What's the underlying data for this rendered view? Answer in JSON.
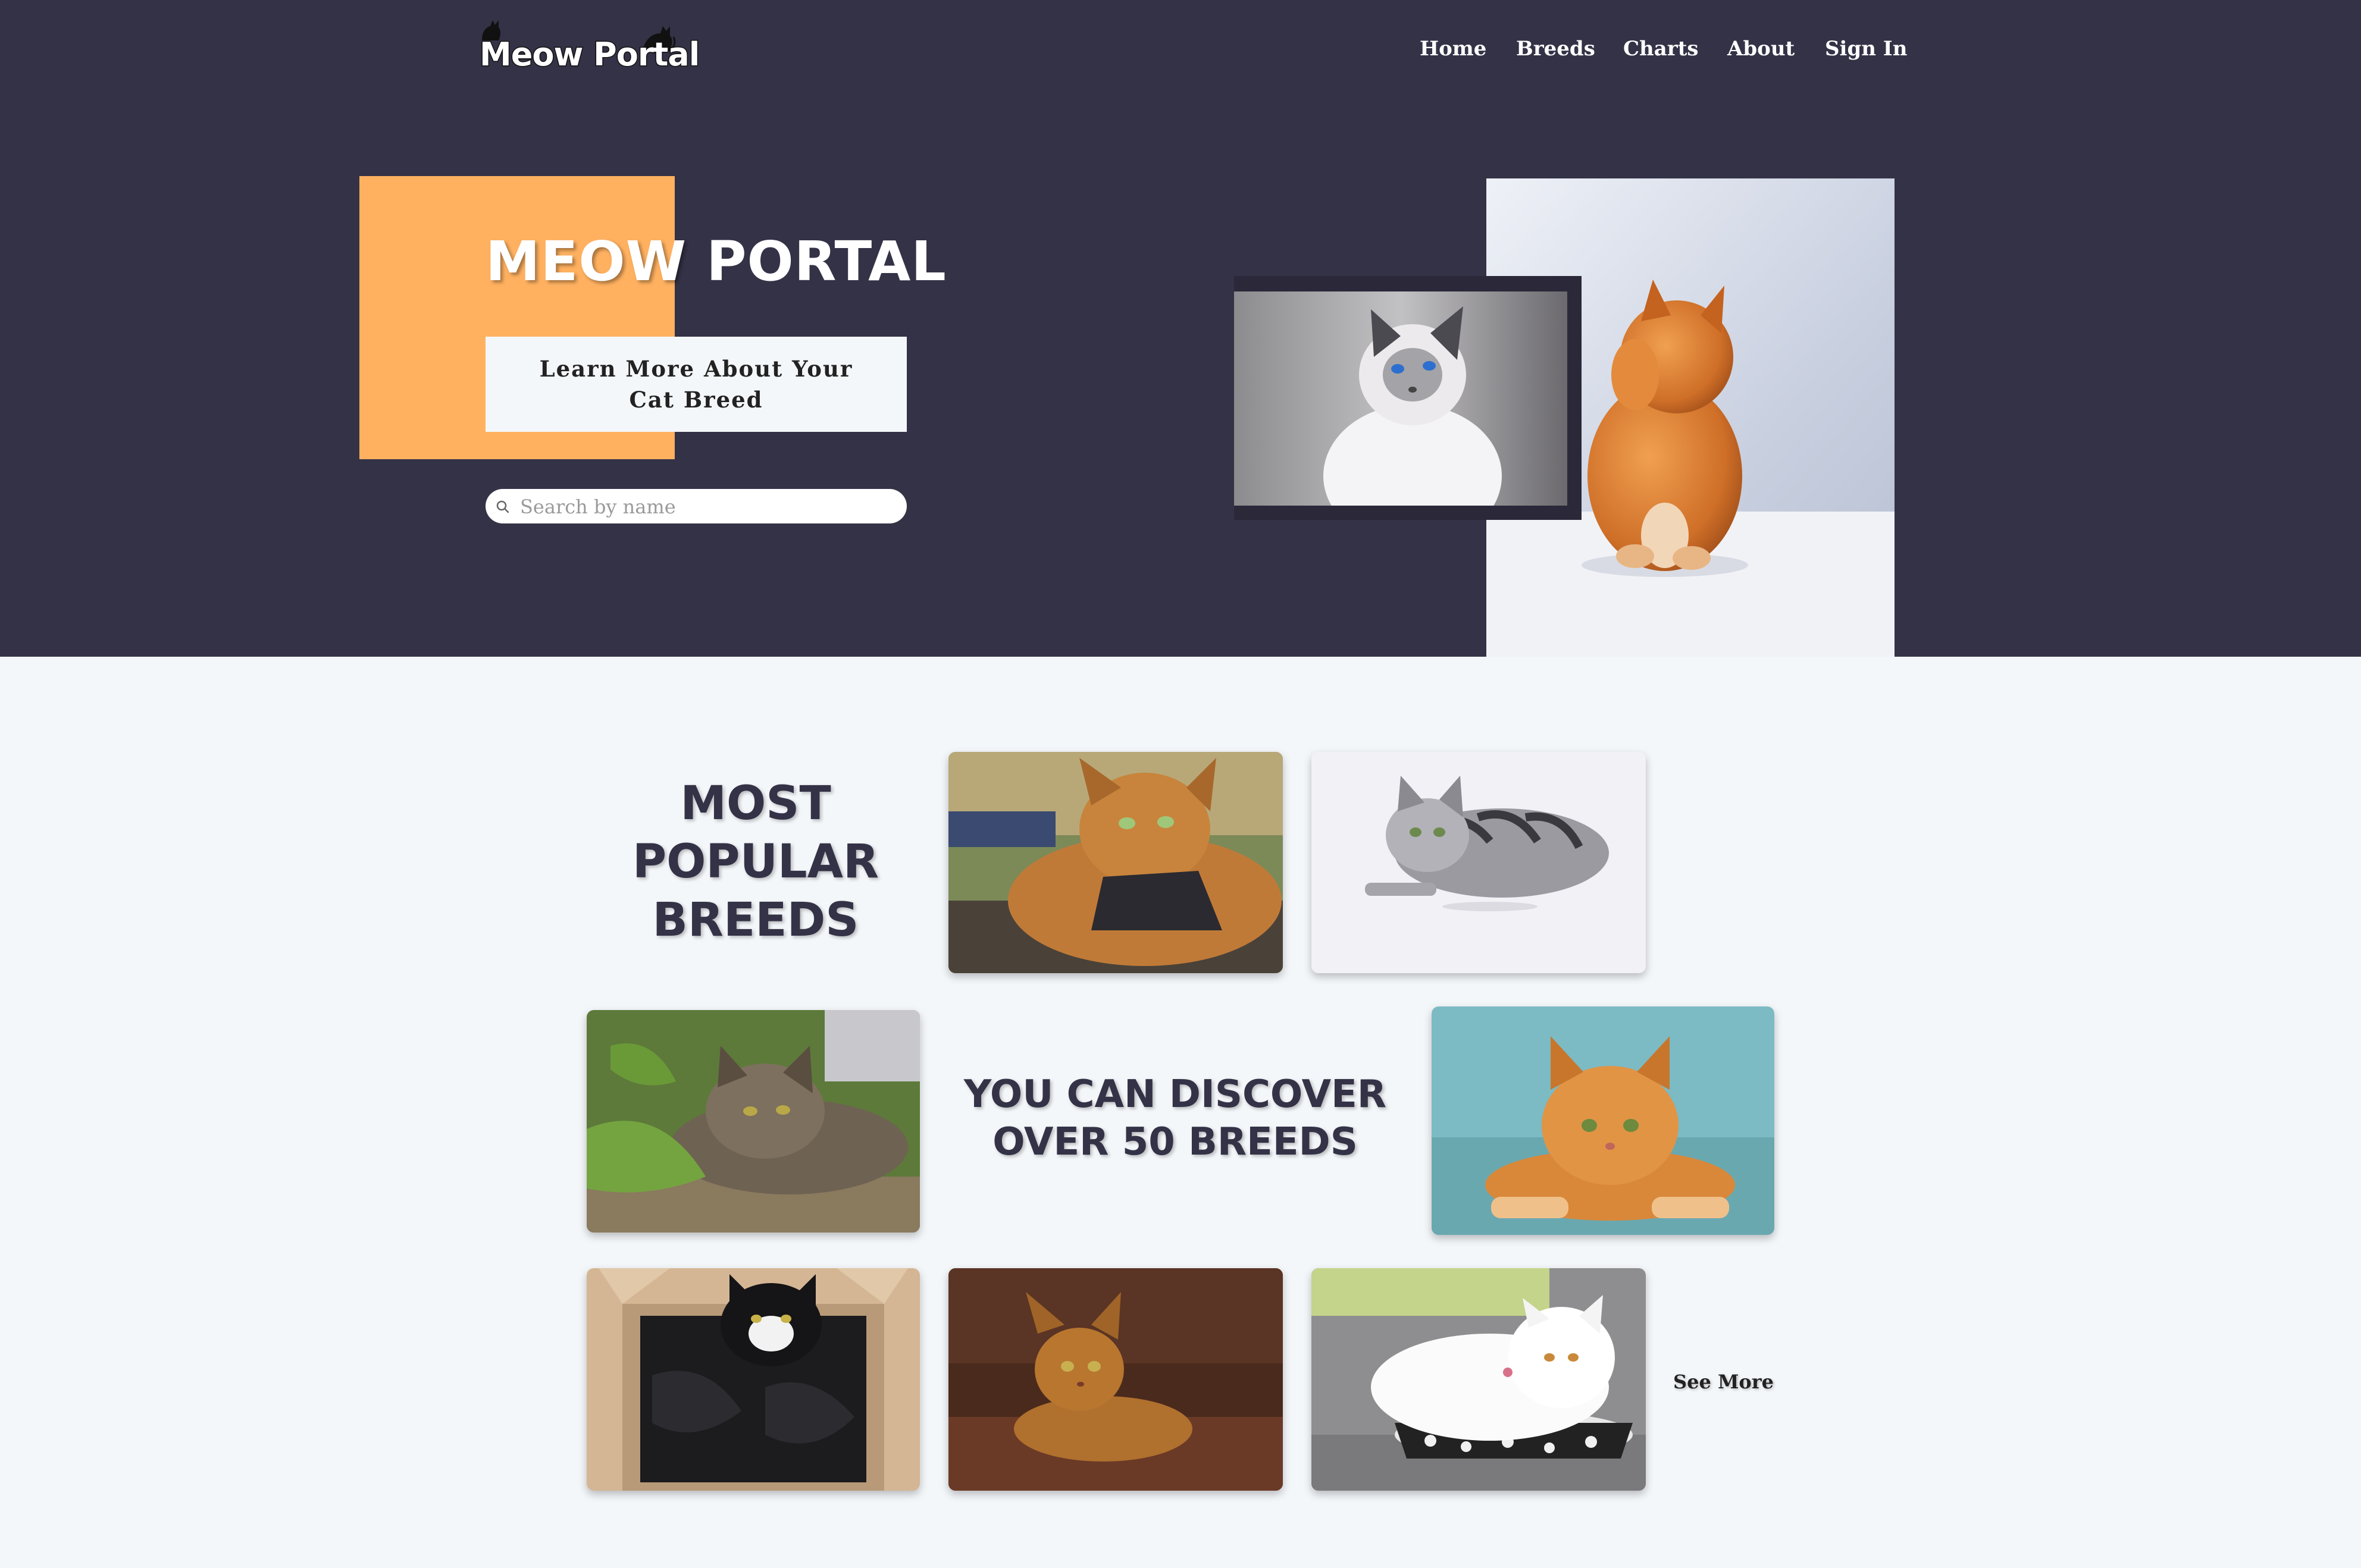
{
  "nav": {
    "logo_text": "Meow Portal",
    "links": [
      "Home",
      "Breeds",
      "Charts",
      "About",
      "Sign In"
    ]
  },
  "hero": {
    "title_word1": "MEOW",
    "title_word2": "PORTAL",
    "cta_label": "Learn More About Your Cat Breed",
    "search_placeholder": "Search by name"
  },
  "section": {
    "heading_popular": "MOST POPULAR BREEDS",
    "heading_discover": "YOU CAN DISCOVER OVER 50 BREEDS",
    "see_more": "See More"
  },
  "colors": {
    "hero_bg": "#343246",
    "accent_orange": "#ffb160",
    "page_bg": "#f4f7fa",
    "heading_text": "#343246"
  }
}
